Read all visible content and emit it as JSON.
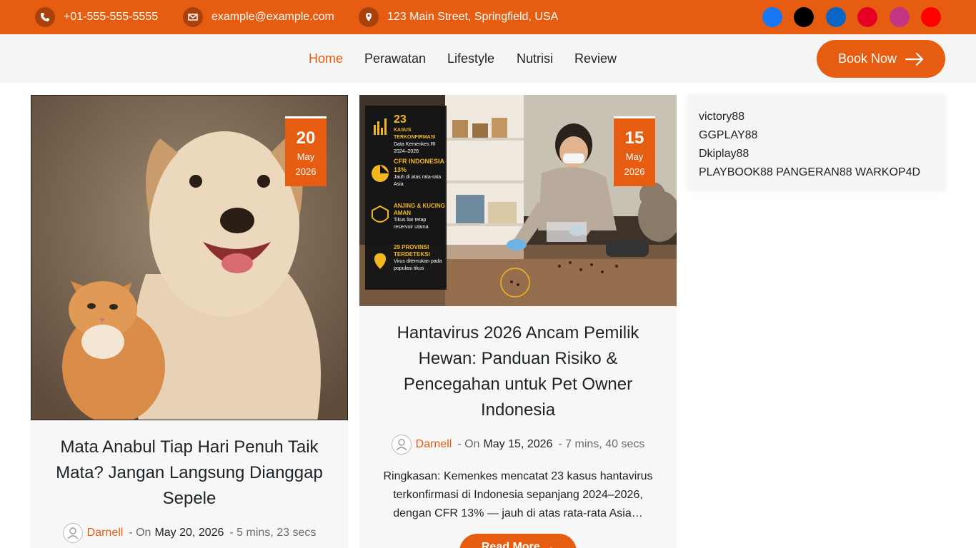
{
  "topbar": {
    "phone": "+01-555-555-5555",
    "email": "example@example.com",
    "address": "123 Main Street, Springfield, USA",
    "contact_icons": [
      "phone-icon",
      "mail-icon",
      "location-icon"
    ],
    "social": [
      {
        "name": "facebook-icon",
        "color": "#1877f2"
      },
      {
        "name": "x-icon",
        "color": "#000000"
      },
      {
        "name": "linkedin-icon",
        "color": "#0a66c2"
      },
      {
        "name": "pinterest-icon",
        "color": "#e60023"
      },
      {
        "name": "instagram-icon",
        "color": "#c13584"
      },
      {
        "name": "youtube-icon",
        "color": "#ff0000"
      }
    ]
  },
  "nav": {
    "items": [
      "Home",
      "Perawatan",
      "Lifestyle",
      "Nutrisi",
      "Review"
    ],
    "active": "Home",
    "book_label": "Book Now"
  },
  "posts": [
    {
      "day": "20",
      "month": "May",
      "year": "2026",
      "title": "Mata Anabul Tiap Hari Penuh Taik Mata? Jangan Langsung Dianggap Sepele",
      "author": "Darnell",
      "on": "- On",
      "date": "May 20, 2026",
      "read_time": "- 5 mins, 23 secs"
    },
    {
      "day": "15",
      "month": "May",
      "year": "2026",
      "title": "Hantavirus 2026 Ancam Pemilik Hewan: Panduan Risiko & Pencegahan untuk Pet Owner Indonesia",
      "author": "Darnell",
      "on": "- On",
      "date": "May 15, 2026",
      "read_time": "- 7 mins, 40 secs",
      "excerpt": "Ringkasan: Kemenkes mencatat 23 kasus hantavirus terkonfirmasi di Indonesia sepanjang 2024–2026, dengan CFR 13% — jauh di atas rata-rata Asia…",
      "read_more": "Read More",
      "infographic": [
        {
          "big": "23",
          "head": "KASUS TERKONFIRMASI",
          "sub": "Data Kemenkes RI 2024–2026"
        },
        {
          "big": "CFR INDONESIA 13%",
          "head": "",
          "sub": "Jauh di atas rata-rata Asia"
        },
        {
          "big": "",
          "head": "ANJING & KUCING AMAN",
          "sub": "Tikus liar tetap reservoir utama"
        },
        {
          "big": "",
          "head": "29 PROVINSI TERDETEKSI",
          "sub": "Virus ditemukan pada populasi tikus"
        }
      ]
    }
  ],
  "sidebar": {
    "links": [
      "victory88",
      "GGPLAY88",
      "Dkiplay88",
      "PLAYBOOK88 PANGERAN88 WARKOP4D"
    ]
  },
  "colors": {
    "accent": "#e65c10"
  }
}
